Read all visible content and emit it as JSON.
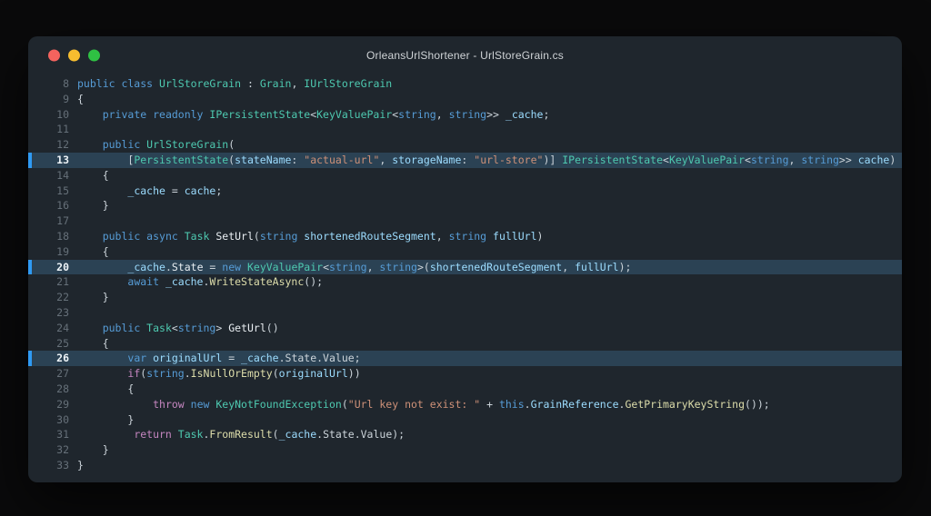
{
  "window": {
    "title": "OrleansUrlShortener - UrlStoreGrain.cs"
  },
  "titlebar": {
    "buttons": [
      {
        "name": "close-button",
        "color": "#f4635e"
      },
      {
        "name": "minimize-button",
        "color": "#f7bd2f"
      },
      {
        "name": "zoom-button",
        "color": "#2fc143"
      }
    ]
  },
  "palette": {
    "page_bg": "#0a0a0b",
    "window_bg": "#1f262d",
    "title_text": "#cfd3d6",
    "line_number": "#667079",
    "highlight_bg": "#2b4254",
    "highlight_bar": "#2f9af3",
    "keyword": "#569cd6",
    "control": "#c586c0",
    "type": "#4ec9b0",
    "variable": "#9cdcfe",
    "string": "#ce9178",
    "function": "#dcdcaa",
    "plain": "#ccd4da",
    "method": "#e9eef2"
  },
  "code": {
    "language": "csharp",
    "first_line": 8,
    "last_line": 33,
    "highlighted_lines": [
      13,
      20,
      26
    ],
    "lines": [
      {
        "n": 8,
        "tokens": [
          {
            "t": "public class ",
            "c": "kw"
          },
          {
            "t": "UrlStoreGrain",
            "c": "type"
          },
          {
            "t": " : ",
            "c": "pl"
          },
          {
            "t": "Grain",
            "c": "type"
          },
          {
            "t": ", ",
            "c": "pl"
          },
          {
            "t": "IUrlStoreGrain",
            "c": "type"
          }
        ]
      },
      {
        "n": 9,
        "tokens": [
          {
            "t": "{",
            "c": "pl"
          }
        ]
      },
      {
        "n": 10,
        "tokens": [
          {
            "t": "    ",
            "c": "pl"
          },
          {
            "t": "private readonly ",
            "c": "kw"
          },
          {
            "t": "IPersistentState",
            "c": "type"
          },
          {
            "t": "<",
            "c": "pl"
          },
          {
            "t": "KeyValuePair",
            "c": "type"
          },
          {
            "t": "<",
            "c": "pl"
          },
          {
            "t": "string",
            "c": "kw"
          },
          {
            "t": ", ",
            "c": "pl"
          },
          {
            "t": "string",
            "c": "kw"
          },
          {
            "t": ">> ",
            "c": "pl"
          },
          {
            "t": "_cache",
            "c": "var"
          },
          {
            "t": ";",
            "c": "pl"
          }
        ]
      },
      {
        "n": 11,
        "tokens": []
      },
      {
        "n": 12,
        "tokens": [
          {
            "t": "    ",
            "c": "pl"
          },
          {
            "t": "public ",
            "c": "kw"
          },
          {
            "t": "UrlStoreGrain",
            "c": "type"
          },
          {
            "t": "(",
            "c": "pl"
          }
        ]
      },
      {
        "n": 13,
        "tokens": [
          {
            "t": "        [",
            "c": "pl"
          },
          {
            "t": "PersistentState",
            "c": "type"
          },
          {
            "t": "(",
            "c": "pl"
          },
          {
            "t": "stateName",
            "c": "var"
          },
          {
            "t": ": ",
            "c": "pl"
          },
          {
            "t": "\"actual-url\"",
            "c": "str"
          },
          {
            "t": ", ",
            "c": "pl"
          },
          {
            "t": "storageName",
            "c": "var"
          },
          {
            "t": ": ",
            "c": "pl"
          },
          {
            "t": "\"url-store\"",
            "c": "str"
          },
          {
            "t": ")] ",
            "c": "pl"
          },
          {
            "t": "IPersistentState",
            "c": "type"
          },
          {
            "t": "<",
            "c": "pl"
          },
          {
            "t": "KeyValuePair",
            "c": "type"
          },
          {
            "t": "<",
            "c": "pl"
          },
          {
            "t": "string",
            "c": "kw"
          },
          {
            "t": ", ",
            "c": "pl"
          },
          {
            "t": "string",
            "c": "kw"
          },
          {
            "t": ">> ",
            "c": "pl"
          },
          {
            "t": "cache",
            "c": "var"
          },
          {
            "t": ")",
            "c": "pl"
          }
        ]
      },
      {
        "n": 14,
        "tokens": [
          {
            "t": "    {",
            "c": "pl"
          }
        ]
      },
      {
        "n": 15,
        "tokens": [
          {
            "t": "        ",
            "c": "pl"
          },
          {
            "t": "_cache",
            "c": "var"
          },
          {
            "t": " = ",
            "c": "pl"
          },
          {
            "t": "cache",
            "c": "var"
          },
          {
            "t": ";",
            "c": "pl"
          }
        ]
      },
      {
        "n": 16,
        "tokens": [
          {
            "t": "    }",
            "c": "pl"
          }
        ]
      },
      {
        "n": 17,
        "tokens": []
      },
      {
        "n": 18,
        "tokens": [
          {
            "t": "    ",
            "c": "pl"
          },
          {
            "t": "public async ",
            "c": "kw"
          },
          {
            "t": "Task ",
            "c": "type"
          },
          {
            "t": "SetUrl",
            "c": "meth"
          },
          {
            "t": "(",
            "c": "pl"
          },
          {
            "t": "string ",
            "c": "kw"
          },
          {
            "t": "shortenedRouteSegment",
            "c": "var"
          },
          {
            "t": ", ",
            "c": "pl"
          },
          {
            "t": "string ",
            "c": "kw"
          },
          {
            "t": "fullUrl",
            "c": "var"
          },
          {
            "t": ")",
            "c": "pl"
          }
        ]
      },
      {
        "n": 19,
        "tokens": [
          {
            "t": "    {",
            "c": "pl"
          }
        ]
      },
      {
        "n": 20,
        "tokens": [
          {
            "t": "        ",
            "c": "pl"
          },
          {
            "t": "_cache",
            "c": "var"
          },
          {
            "t": ".",
            "c": "pl"
          },
          {
            "t": "State",
            "c": "meth"
          },
          {
            "t": " = ",
            "c": "pl"
          },
          {
            "t": "new ",
            "c": "kw"
          },
          {
            "t": "KeyValuePair",
            "c": "type"
          },
          {
            "t": "<",
            "c": "pl"
          },
          {
            "t": "string",
            "c": "kw"
          },
          {
            "t": ", ",
            "c": "pl"
          },
          {
            "t": "string",
            "c": "kw"
          },
          {
            "t": ">(",
            "c": "pl"
          },
          {
            "t": "shortenedRouteSegment",
            "c": "var"
          },
          {
            "t": ", ",
            "c": "pl"
          },
          {
            "t": "fullUrl",
            "c": "var"
          },
          {
            "t": ");",
            "c": "pl"
          }
        ]
      },
      {
        "n": 21,
        "tokens": [
          {
            "t": "        ",
            "c": "pl"
          },
          {
            "t": "await ",
            "c": "kw"
          },
          {
            "t": "_cache",
            "c": "var"
          },
          {
            "t": ".",
            "c": "pl"
          },
          {
            "t": "WriteStateAsync",
            "c": "fn"
          },
          {
            "t": "();",
            "c": "pl"
          }
        ]
      },
      {
        "n": 22,
        "tokens": [
          {
            "t": "    }",
            "c": "pl"
          }
        ]
      },
      {
        "n": 23,
        "tokens": []
      },
      {
        "n": 24,
        "tokens": [
          {
            "t": "    ",
            "c": "pl"
          },
          {
            "t": "public ",
            "c": "kw"
          },
          {
            "t": "Task",
            "c": "type"
          },
          {
            "t": "<",
            "c": "pl"
          },
          {
            "t": "string",
            "c": "kw"
          },
          {
            "t": "> ",
            "c": "pl"
          },
          {
            "t": "GetUrl",
            "c": "meth"
          },
          {
            "t": "()",
            "c": "pl"
          }
        ]
      },
      {
        "n": 25,
        "tokens": [
          {
            "t": "    {",
            "c": "pl"
          }
        ]
      },
      {
        "n": 26,
        "tokens": [
          {
            "t": "        ",
            "c": "pl"
          },
          {
            "t": "var ",
            "c": "kw"
          },
          {
            "t": "originalUrl",
            "c": "var"
          },
          {
            "t": " = ",
            "c": "pl"
          },
          {
            "t": "_cache",
            "c": "var"
          },
          {
            "t": ".State.Value;",
            "c": "pl"
          }
        ]
      },
      {
        "n": 27,
        "tokens": [
          {
            "t": "        ",
            "c": "pl"
          },
          {
            "t": "if",
            "c": "ctrl"
          },
          {
            "t": "(",
            "c": "pl"
          },
          {
            "t": "string",
            "c": "kw"
          },
          {
            "t": ".",
            "c": "pl"
          },
          {
            "t": "IsNullOrEmpty",
            "c": "fn"
          },
          {
            "t": "(",
            "c": "pl"
          },
          {
            "t": "originalUrl",
            "c": "var"
          },
          {
            "t": "))",
            "c": "pl"
          }
        ]
      },
      {
        "n": 28,
        "tokens": [
          {
            "t": "        {",
            "c": "pl"
          }
        ]
      },
      {
        "n": 29,
        "tokens": [
          {
            "t": "            ",
            "c": "pl"
          },
          {
            "t": "throw ",
            "c": "ctrl"
          },
          {
            "t": "new ",
            "c": "kw"
          },
          {
            "t": "KeyNotFoundException",
            "c": "type"
          },
          {
            "t": "(",
            "c": "pl"
          },
          {
            "t": "\"Url key not exist: \"",
            "c": "str"
          },
          {
            "t": " + ",
            "c": "pl"
          },
          {
            "t": "this",
            "c": "kw"
          },
          {
            "t": ".",
            "c": "pl"
          },
          {
            "t": "GrainReference",
            "c": "var"
          },
          {
            "t": ".",
            "c": "pl"
          },
          {
            "t": "GetPrimaryKeyString",
            "c": "fn"
          },
          {
            "t": "());",
            "c": "pl"
          }
        ]
      },
      {
        "n": 30,
        "tokens": [
          {
            "t": "        }",
            "c": "pl"
          }
        ]
      },
      {
        "n": 31,
        "tokens": [
          {
            "t": "         ",
            "c": "pl"
          },
          {
            "t": "return ",
            "c": "ctrl"
          },
          {
            "t": "Task",
            "c": "type"
          },
          {
            "t": ".",
            "c": "pl"
          },
          {
            "t": "FromResult",
            "c": "fn"
          },
          {
            "t": "(",
            "c": "pl"
          },
          {
            "t": "_cache",
            "c": "var"
          },
          {
            "t": ".State.Value",
            "c": "pl"
          },
          {
            "t": ");",
            "c": "pl"
          }
        ]
      },
      {
        "n": 32,
        "tokens": [
          {
            "t": "    }",
            "c": "pl"
          }
        ]
      },
      {
        "n": 33,
        "tokens": [
          {
            "t": "}",
            "c": "pl"
          }
        ]
      }
    ]
  }
}
